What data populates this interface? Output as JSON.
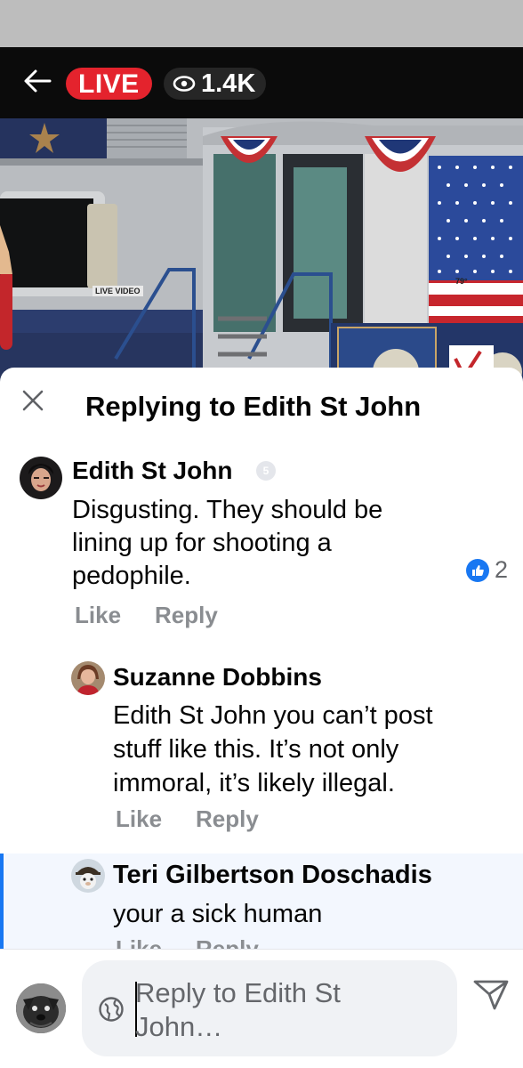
{
  "video": {
    "live_label": "LIVE",
    "viewer_count": "1.4K",
    "live_video_tag": "LIVE VIDEO",
    "temperature": "79°"
  },
  "sheet": {
    "title": "Replying to Edith St John"
  },
  "comments": [
    {
      "author": "Edith St John",
      "text_lines": [
        "Disgusting. They should be",
        "lining up for shooting a",
        "pedophile."
      ],
      "like_count": "2",
      "like_label": "Like",
      "reply_label": "Reply"
    },
    {
      "author": "Suzanne Dobbins",
      "text_lines": [
        "Edith St John you can’t post",
        "stuff like this. It’s not only",
        "immoral, it’s likely illegal."
      ],
      "like_label": "Like",
      "reply_label": "Reply"
    },
    {
      "author": "Teri Gilbertson Doschadis",
      "text_lines": [
        "your a sick human"
      ],
      "like_label": "Like",
      "reply_label": "Reply"
    }
  ],
  "composer": {
    "placeholder_lines": [
      "Reply to Edith St",
      "John…"
    ]
  },
  "colors": {
    "live_red": "#e4232d",
    "facebook_blue": "#1877f2",
    "muted_gray": "#8a8d91"
  },
  "icons": {
    "back": "arrow-left-icon",
    "eye": "eye-icon",
    "close": "close-icon",
    "like": "thumbs-up-icon",
    "globe": "globe-icon",
    "send": "send-icon"
  }
}
